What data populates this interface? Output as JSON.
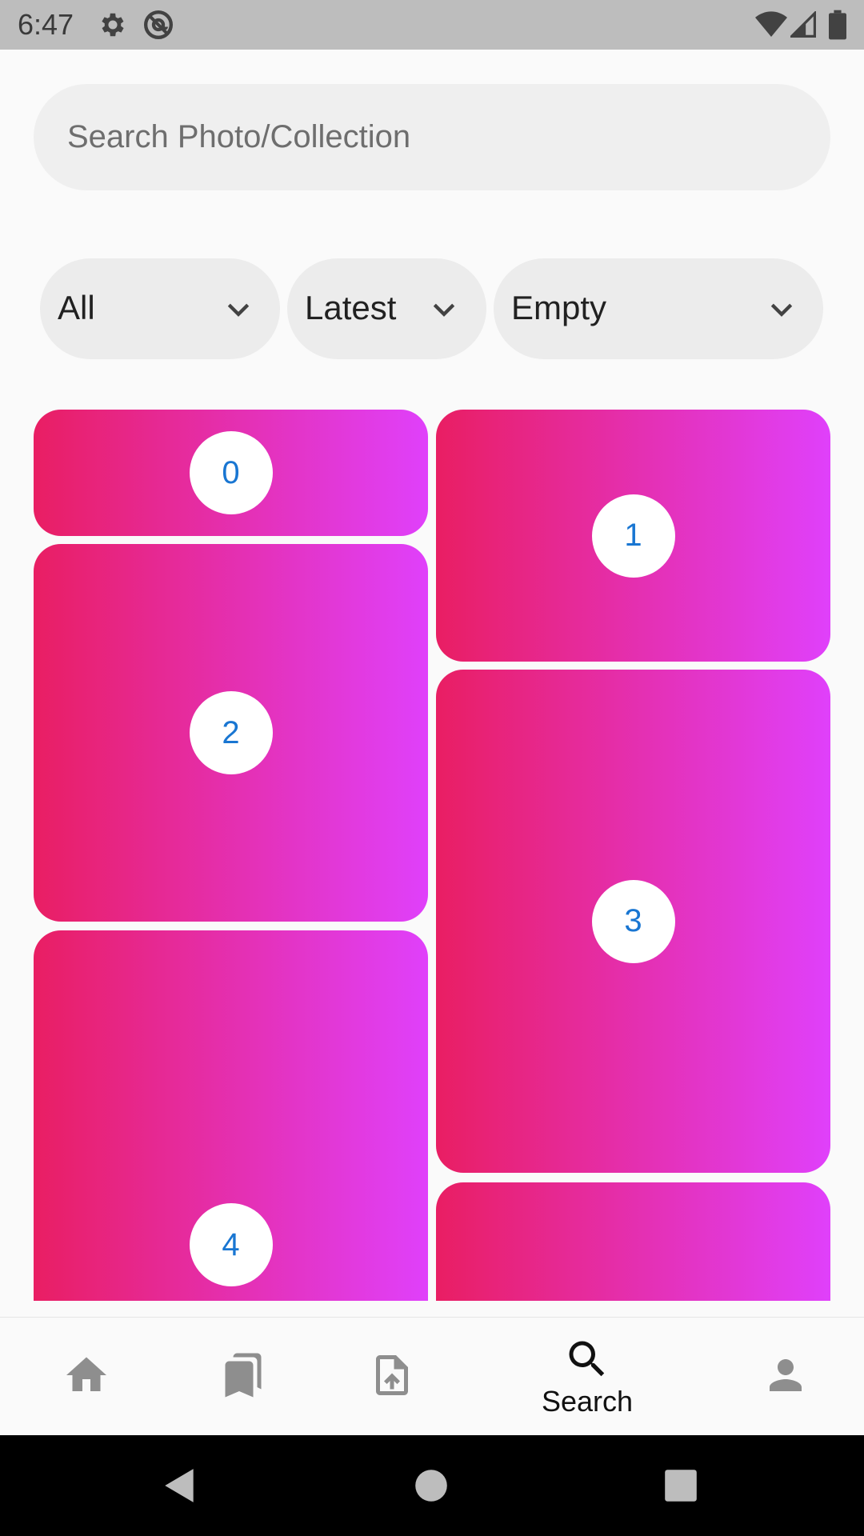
{
  "status_bar": {
    "time": "6:47",
    "icons": [
      "settings-gear-icon",
      "at-sign-icon",
      "wifi-icon",
      "cell-signal-icon",
      "battery-icon"
    ]
  },
  "search": {
    "placeholder": "Search Photo/Collection",
    "value": ""
  },
  "filters": [
    {
      "selected": "All",
      "icon": "chevron-down-icon"
    },
    {
      "selected": "Latest",
      "icon": "chevron-down-icon"
    },
    {
      "selected": "Empty",
      "icon": "chevron-down-icon"
    }
  ],
  "grid": {
    "gradient": [
      "#e91e63",
      "#e040fb"
    ],
    "badge_color": "#1976d2",
    "tiles": [
      {
        "label": "0"
      },
      {
        "label": "1"
      },
      {
        "label": "2"
      },
      {
        "label": "3"
      },
      {
        "label": "4"
      },
      {
        "label": ""
      }
    ]
  },
  "bottom_nav": {
    "items": [
      {
        "icon": "home-icon",
        "label": ""
      },
      {
        "icon": "bookmarks-icon",
        "label": ""
      },
      {
        "icon": "upload-file-icon",
        "label": ""
      },
      {
        "icon": "search-icon",
        "label": "Search",
        "active": true
      },
      {
        "icon": "person-icon",
        "label": ""
      }
    ]
  },
  "system_nav": {
    "icons": [
      "back-icon",
      "home-circle-icon",
      "recents-icon"
    ]
  }
}
